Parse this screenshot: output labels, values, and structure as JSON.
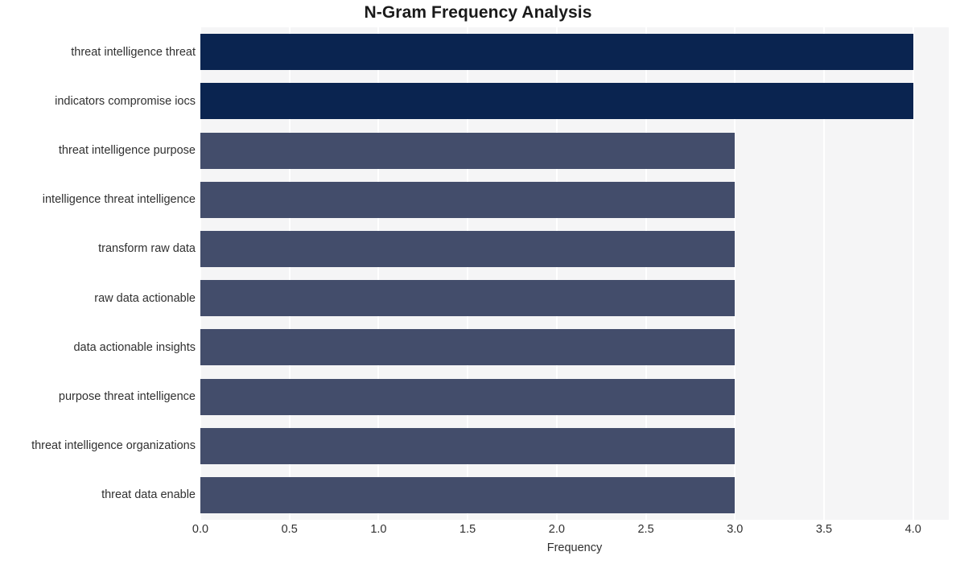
{
  "chart_data": {
    "type": "bar",
    "orientation": "horizontal",
    "title": "N-Gram Frequency Analysis",
    "xlabel": "Frequency",
    "ylabel": "",
    "xlim": [
      0,
      4.2
    ],
    "xticks": [
      "0.0",
      "0.5",
      "1.0",
      "1.5",
      "2.0",
      "2.5",
      "3.0",
      "3.5",
      "4.0"
    ],
    "xtick_values": [
      0.0,
      0.5,
      1.0,
      1.5,
      2.0,
      2.5,
      3.0,
      3.5,
      4.0
    ],
    "grid": "vertical-white-gridlines",
    "legend": "none",
    "categories": [
      "threat intelligence threat",
      "indicators compromise iocs",
      "threat intelligence purpose",
      "intelligence threat intelligence",
      "transform raw data",
      "raw data actionable",
      "data actionable insights",
      "purpose threat intelligence",
      "threat intelligence organizations",
      "threat data enable"
    ],
    "values": [
      4,
      4,
      3,
      3,
      3,
      3,
      3,
      3,
      3,
      3
    ],
    "bar_colors": [
      "#0a2450",
      "#0a2450",
      "#434d6b",
      "#434d6b",
      "#434d6b",
      "#434d6b",
      "#434d6b",
      "#434d6b",
      "#434d6b",
      "#434d6b"
    ],
    "plot_background": "#f5f5f6",
    "figure_background": "#ffffff",
    "gridline_color": "#ffffff"
  }
}
